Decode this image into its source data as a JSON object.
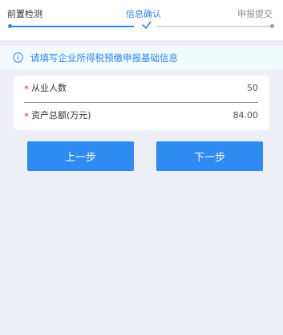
{
  "steps": [
    {
      "label": "前置检测",
      "state": "done"
    },
    {
      "label": "信息确认",
      "state": "current"
    },
    {
      "label": "申报提交",
      "state": "pending"
    }
  ],
  "notice": {
    "icon": "info-icon",
    "text": "请填写企业所得税预缴申报基础信息"
  },
  "fields": [
    {
      "required_mark": "*",
      "label": "从业人数",
      "value": "50"
    },
    {
      "required_mark": "*",
      "label": "资产总额(万元)",
      "value": "84.00"
    }
  ],
  "buttons": {
    "prev_label": "上一步",
    "next_label": "下一步"
  },
  "colors": {
    "accent": "#2f86ef",
    "required": "#e0383e",
    "background": "#eeeef6",
    "notice_bg": "#f2fbfc"
  }
}
